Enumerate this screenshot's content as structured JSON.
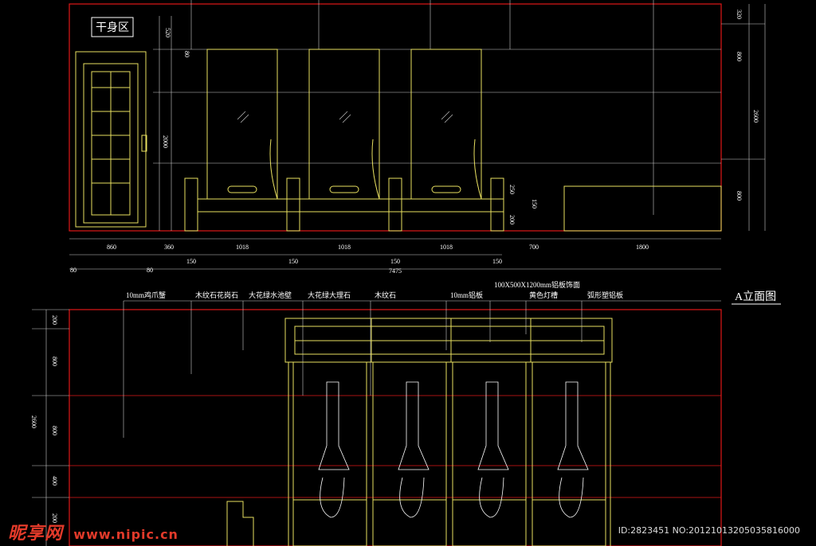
{
  "elevation_a": {
    "title": "A立面图",
    "zone_label": "干身区",
    "dims_bottom": [
      "860",
      "360",
      "1018",
      "1018",
      "1018",
      "700",
      "1800"
    ],
    "dims_gap": [
      "150",
      "150",
      "150",
      "150"
    ],
    "dims_edge": [
      "80",
      "80"
    ],
    "dim_total": "7475",
    "dims_top_left": [
      "520",
      "80",
      "2000"
    ],
    "dims_right": [
      "320",
      "800",
      "2600",
      "800"
    ],
    "dims_inner": [
      "250",
      "150",
      "200"
    ],
    "spec_label": "100X500X1200mm铝板饰面"
  },
  "elevation_b": {
    "callouts": [
      "10mm鸡爪蟹",
      "木纹石花岗石",
      "大花绿水池壁",
      "大花绿大理石",
      "木纹石",
      "10mm铝板",
      "黄色灯槽",
      "弧形塑铝板"
    ],
    "dims_left": [
      "200",
      "800",
      "2600",
      "800",
      "400",
      "200"
    ]
  },
  "watermark": {
    "logo": "昵享网",
    "url": "www.nipic.cn",
    "id": "ID:2823451 NO:20121013205035816000"
  },
  "colors": {
    "red": "#e01818",
    "yellow": "#e8e060",
    "white": "#ffffff",
    "bg": "#000000"
  }
}
